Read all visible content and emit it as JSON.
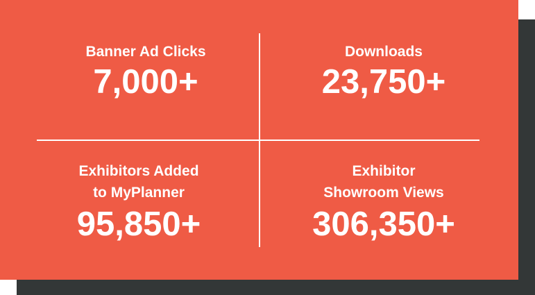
{
  "stats": [
    {
      "label_lines": [
        "Banner Ad Clicks"
      ],
      "value": "7,000+"
    },
    {
      "label_lines": [
        "Downloads"
      ],
      "value": "23,750+"
    },
    {
      "label_lines": [
        "Exhibitors Added",
        "to MyPlanner"
      ],
      "value": "95,850+"
    },
    {
      "label_lines": [
        "Exhibitor",
        "Showroom Views"
      ],
      "value": "306,350+"
    }
  ],
  "colors": {
    "card": "#ef5b45",
    "shadow": "#333737",
    "text": "#ffffff"
  }
}
